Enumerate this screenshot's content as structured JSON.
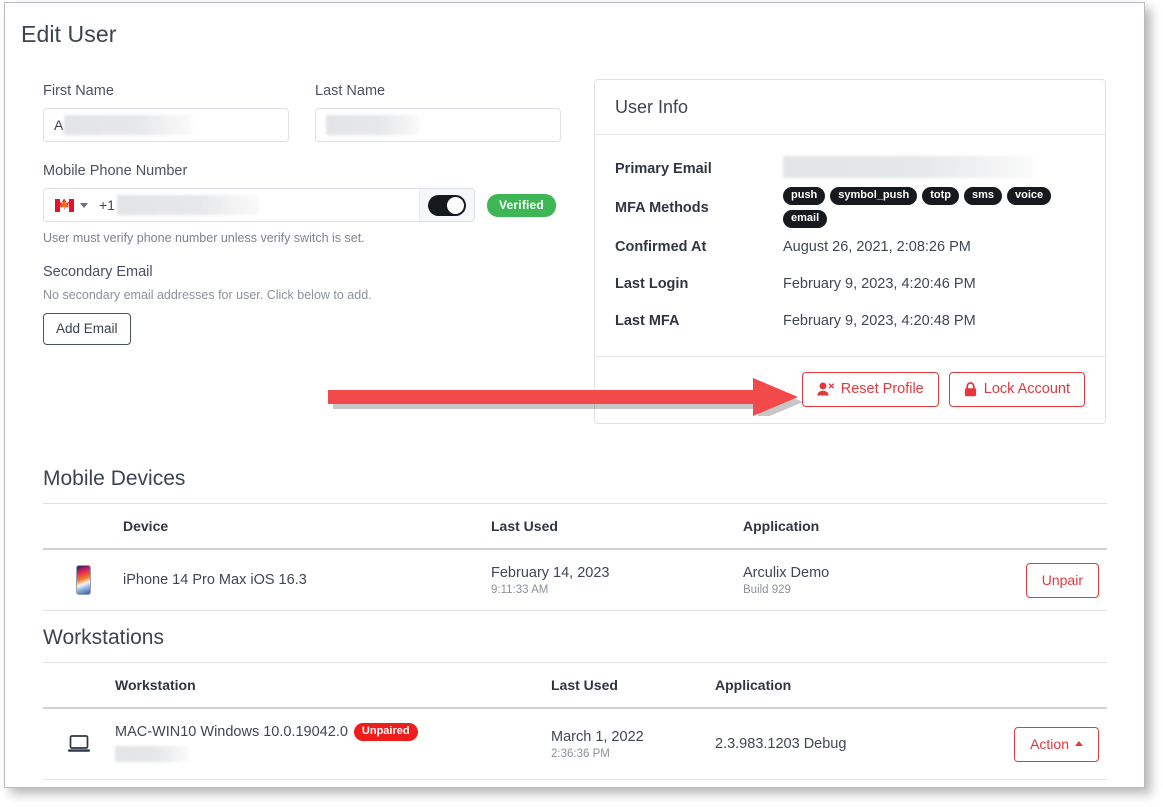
{
  "page": {
    "title": "Edit User"
  },
  "form": {
    "first_name": {
      "label": "First Name",
      "value": "A"
    },
    "last_name": {
      "label": "Last Name",
      "value": ""
    },
    "phone": {
      "label": "Mobile Phone Number",
      "country_flag": "canada-flag-icon",
      "dial_code": "+1",
      "value": "",
      "verify_toggle_on": true,
      "verified_label": "Verified",
      "hint": "User must verify phone number unless verify switch is set."
    },
    "secondary_email": {
      "label": "Secondary Email",
      "note": "No secondary email addresses for user. Click below to add.",
      "add_button": "Add Email"
    }
  },
  "user_info": {
    "title": "User Info",
    "rows": [
      {
        "key": "Primary Email",
        "value": ""
      },
      {
        "key": "MFA Methods",
        "value": ""
      },
      {
        "key": "Confirmed At",
        "value": "August 26, 2021, 2:08:26 PM"
      },
      {
        "key": "Last Login",
        "value": "February 9, 2023, 4:20:46 PM"
      },
      {
        "key": "Last MFA",
        "value": "February 9, 2023, 4:20:48 PM"
      }
    ],
    "mfa_methods": [
      "push",
      "symbol_push",
      "totp",
      "sms",
      "voice",
      "email"
    ],
    "actions": {
      "reset_profile": "Reset Profile",
      "lock_account": "Lock Account"
    }
  },
  "annotation": {
    "arrow_color": "#f2494b",
    "points_to": "Reset Profile"
  },
  "mobile_devices": {
    "title": "Mobile Devices",
    "columns": [
      "Device",
      "Last Used",
      "Application"
    ],
    "rows": [
      {
        "icon": "iphone-icon",
        "device": "iPhone 14 Pro Max iOS 16.3",
        "last_used_date": "February 14, 2023",
        "last_used_time": "9:11:33 AM",
        "application": "Arculix Demo",
        "application_build": "Build 929",
        "action_label": "Unpair"
      }
    ]
  },
  "workstations": {
    "title": "Workstations",
    "columns": [
      "Workstation",
      "Last Used",
      "Application"
    ],
    "rows": [
      {
        "icon": "laptop-icon",
        "workstation": "MAC-WIN10 Windows 10.0.19042.0",
        "status_badge": "Unpaired",
        "workstation_sub": "",
        "last_used_date": "March 1, 2022",
        "last_used_time": "2:36:36 PM",
        "application": "2.3.983.1203 Debug",
        "action_label": "Action"
      }
    ]
  },
  "colors": {
    "danger": "#e8373c",
    "success": "#3eb655",
    "badge_dark": "#16191d",
    "unpaired": "#ef1c1c"
  }
}
